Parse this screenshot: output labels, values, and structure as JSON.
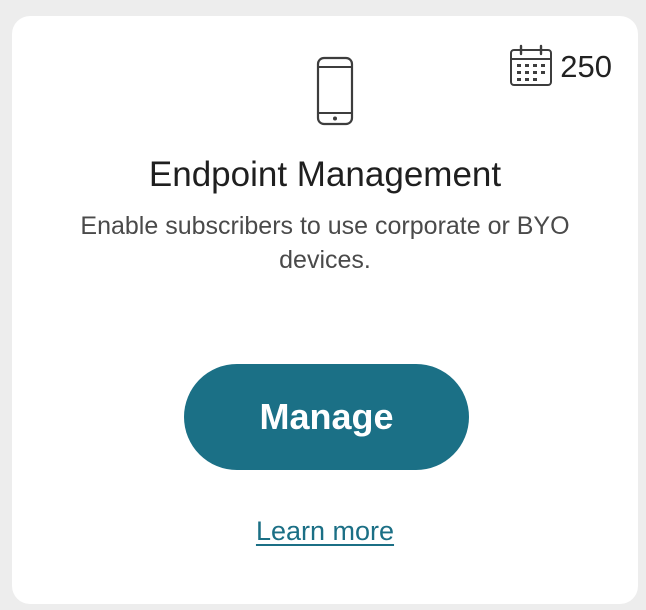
{
  "card": {
    "icon": "mobile-phone-icon",
    "counter": {
      "icon": "calendar-icon",
      "value": "250"
    },
    "title": "Endpoint Management",
    "description": "Enable subscribers to use corporate or BYO devices.",
    "primary_action": "Manage",
    "link_label": "Learn more"
  },
  "colors": {
    "accent": "#1b7086",
    "link": "#1b6f85",
    "card_background": "#ffffff",
    "page_background": "#ededed"
  }
}
